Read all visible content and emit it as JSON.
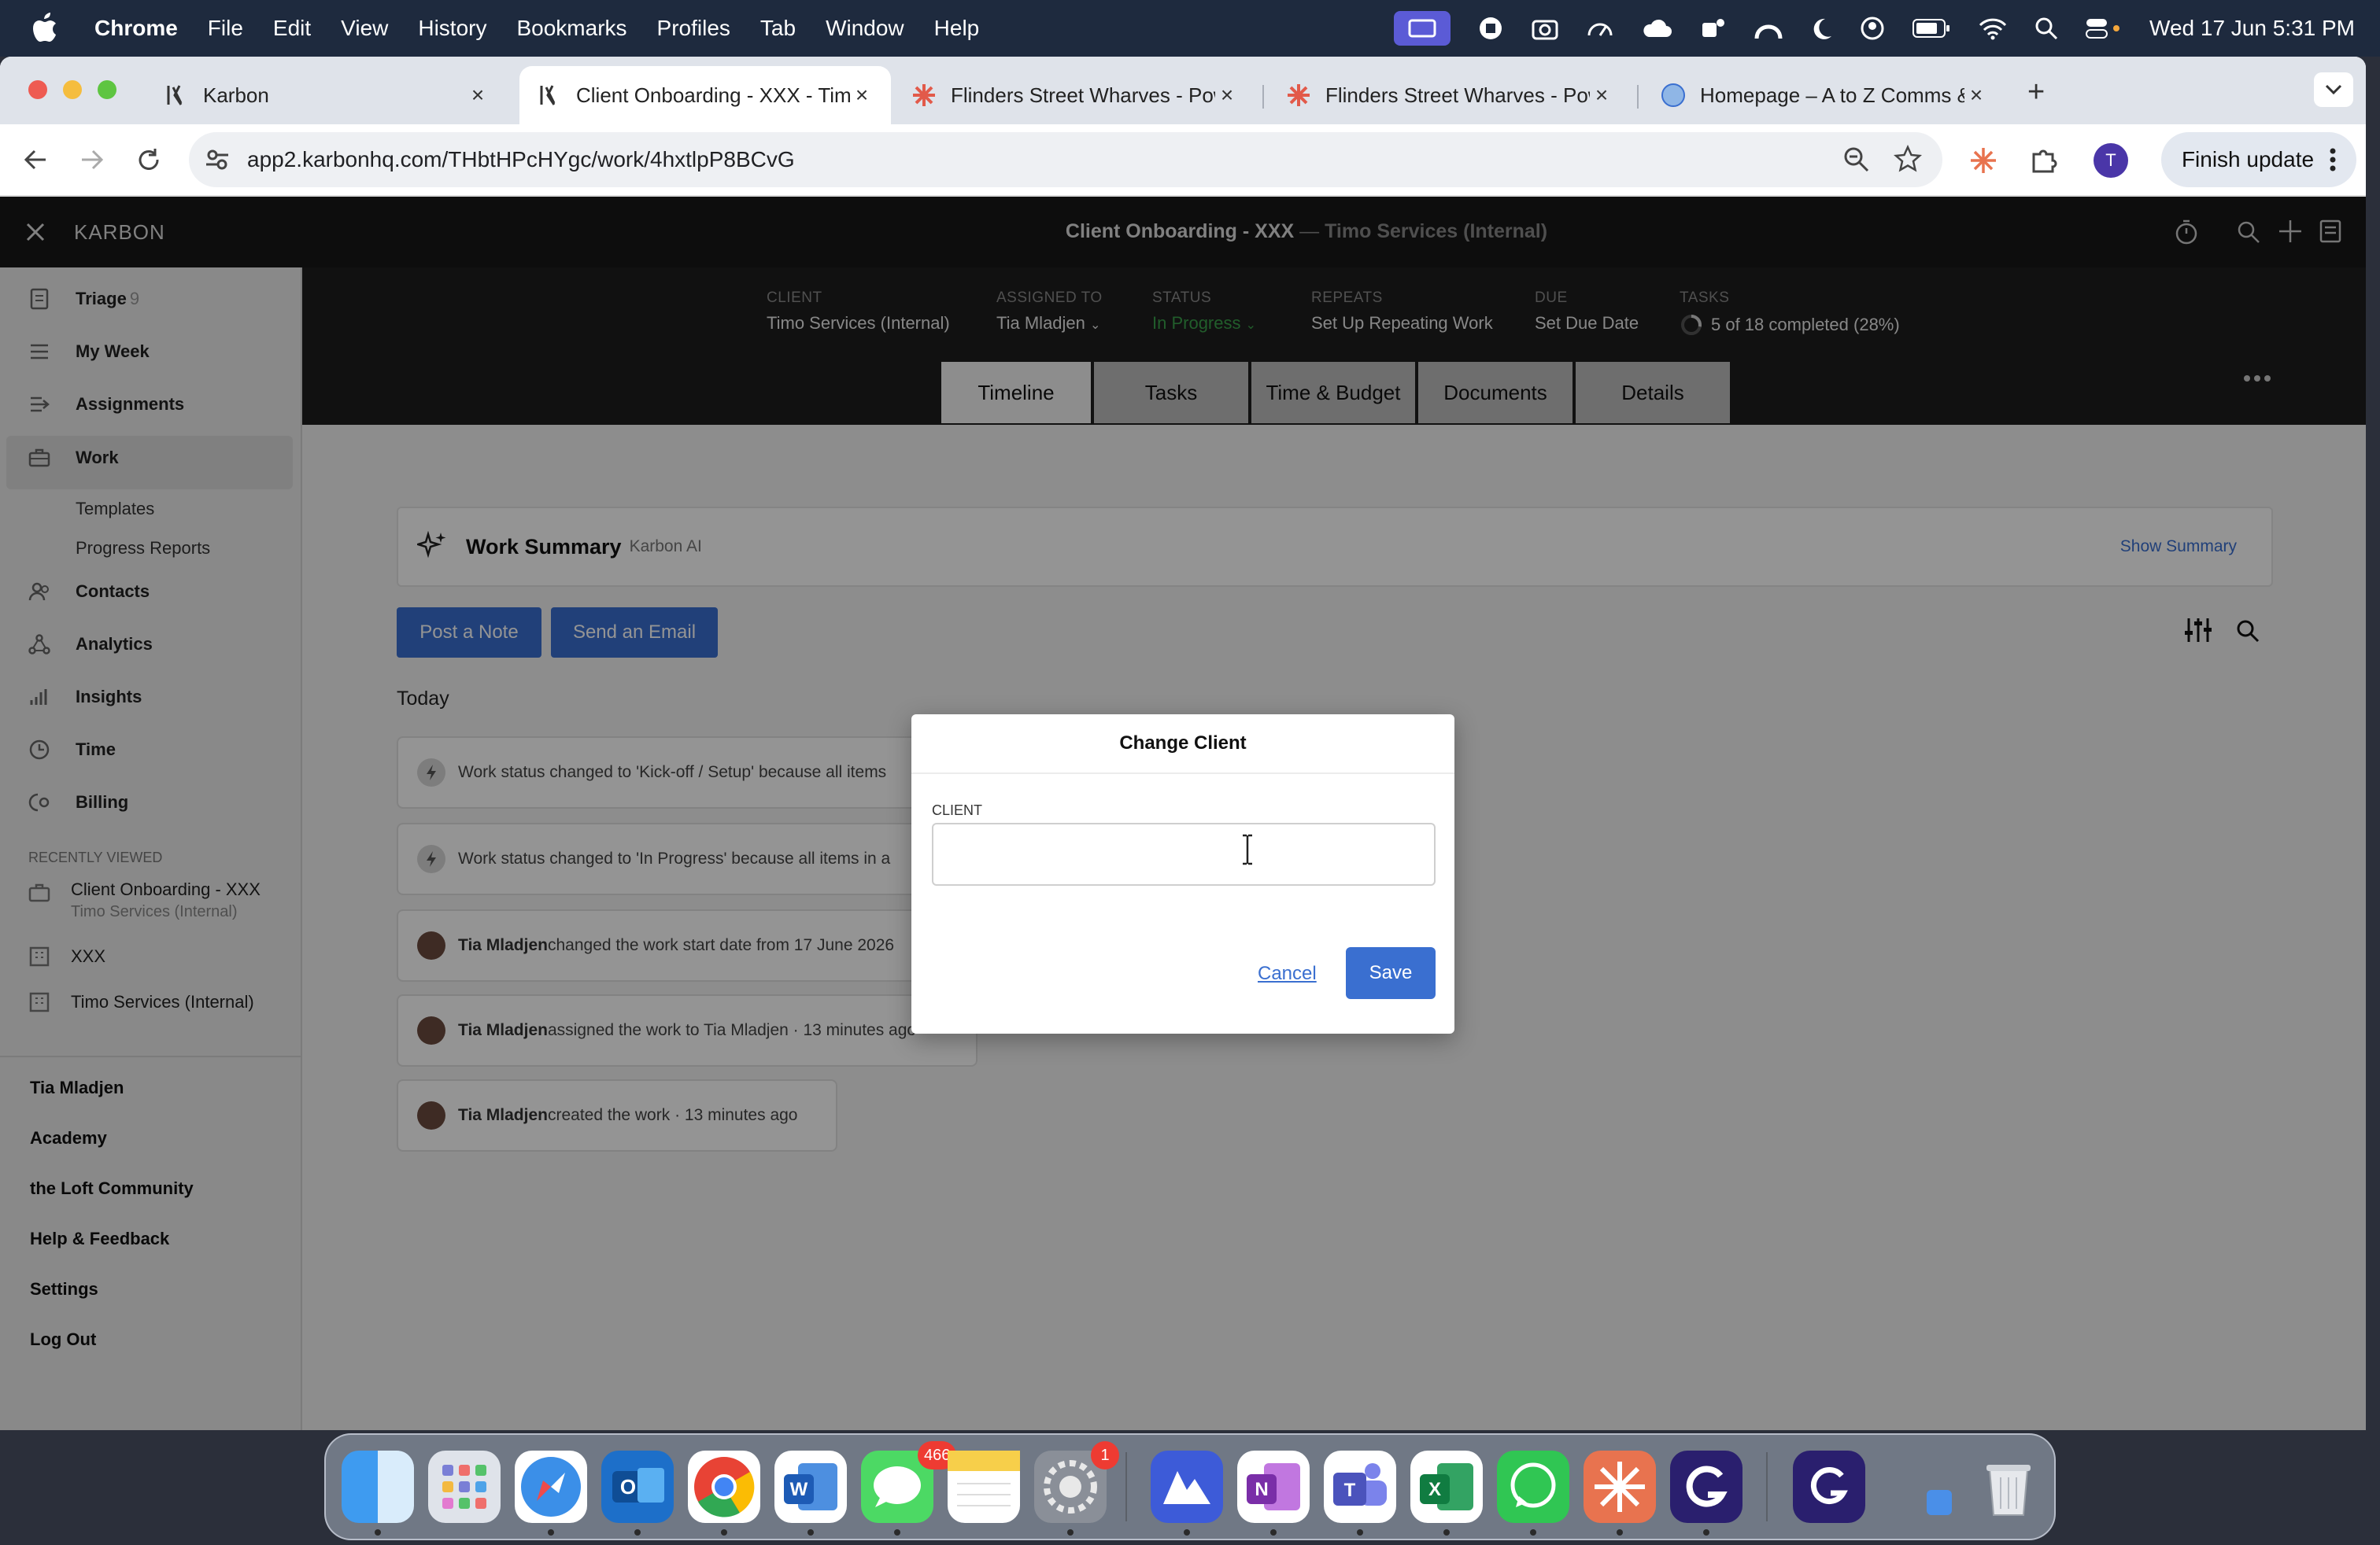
{
  "menubar": {
    "app_name": "Chrome",
    "items": [
      "File",
      "Edit",
      "View",
      "History",
      "Bookmarks",
      "Profiles",
      "Tab",
      "Window",
      "Help"
    ],
    "clock": "Wed 17 Jun  5:31 PM"
  },
  "browser": {
    "tabs": [
      {
        "title": "Karbon"
      },
      {
        "title": "Client Onboarding - XXX - Timo Services (Internal)"
      },
      {
        "title": "Flinders Street Wharves - Power"
      },
      {
        "title": "Flinders Street Wharves - Power"
      },
      {
        "title": "Homepage – A to Z Comms & IT"
      }
    ],
    "url": "app2.karbonhq.com/THbtHPcHYgc/work/4hxtlpP8BCvG",
    "profile_initial": "T",
    "finish_update": "Finish update"
  },
  "app": {
    "brand": "KARBON",
    "header_title": "Client Onboarding - XXX",
    "header_sep": " — ",
    "header_client": "Timo Services (Internal)",
    "meta": {
      "client_label": "CLIENT",
      "client_value": "Timo Services (Internal)",
      "assigned_label": "ASSIGNED TO",
      "assigned_value": "Tia Mladjen",
      "status_label": "STATUS",
      "status_value": "In Progress",
      "repeats_label": "REPEATS",
      "repeats_value": "Set Up Repeating Work",
      "due_label": "DUE",
      "due_value": "Set Due Date",
      "tasks_label": "TASKS",
      "tasks_value": "5 of 18 completed (28%)",
      "tasks_progress": 0.28
    },
    "tabs": [
      "Timeline",
      "Tasks",
      "Time & Budget",
      "Documents",
      "Details"
    ],
    "work_summary": {
      "title": "Work Summary",
      "subtitle": "Karbon AI",
      "show": "Show Summary"
    },
    "buttons": {
      "post_note": "Post a Note",
      "send_email": "Send an Email"
    },
    "today": "Today",
    "timeline": [
      {
        "actor": "",
        "text": "Work status changed to 'Kick-off / Setup' because all items"
      },
      {
        "actor": "",
        "text": "Work status changed to 'In Progress' because all items in a"
      },
      {
        "actor": "Tia Mladjen",
        "text": " changed the work start date from 17 June 2026"
      },
      {
        "actor": "Tia Mladjen",
        "text": " assigned the work to Tia Mladjen · 13 minutes ago"
      },
      {
        "actor": "Tia Mladjen",
        "text": " created the work · 13 minutes ago"
      }
    ]
  },
  "sidebar": {
    "nav": [
      {
        "label": "Triage",
        "count": "9"
      },
      {
        "label": "My Week"
      },
      {
        "label": "Assignments"
      },
      {
        "label": "Work"
      },
      {
        "label": "Contacts"
      },
      {
        "label": "Analytics"
      },
      {
        "label": "Insights"
      },
      {
        "label": "Time"
      },
      {
        "label": "Billing"
      }
    ],
    "work_sub": [
      "Templates",
      "Progress Reports"
    ],
    "recently_viewed_label": "RECENTLY VIEWED",
    "recent": [
      {
        "title": "Client Onboarding - XXX",
        "sub": "Timo Services (Internal)"
      },
      {
        "title": "XXX"
      },
      {
        "title": "Timo Services (Internal)"
      }
    ],
    "footer": [
      "Tia Mladjen",
      "Academy",
      "the Loft Community",
      "Help & Feedback",
      "Settings",
      "Log Out"
    ]
  },
  "modal": {
    "title": "Change Client",
    "client_label": "CLIENT",
    "client_value": "",
    "cancel": "Cancel",
    "save": "Save"
  },
  "dock": {
    "badges": {
      "messages": "466",
      "settings": "1"
    }
  }
}
